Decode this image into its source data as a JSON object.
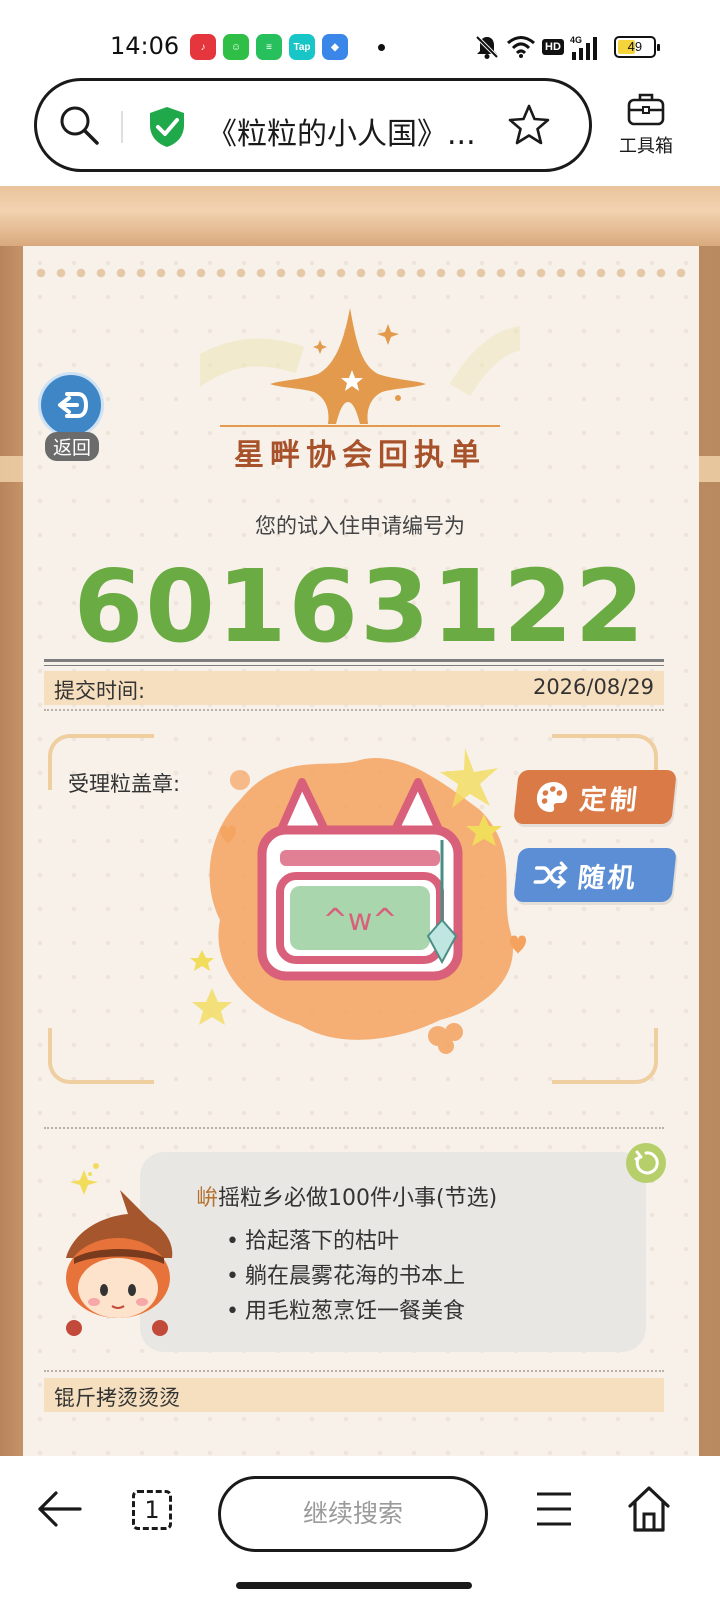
{
  "status_bar": {
    "time": "14:06",
    "battery_percent": "49",
    "battery_level": 0.49,
    "app_icons": [
      {
        "name": "music-app-icon",
        "label": "♪",
        "color": "#e5353d"
      },
      {
        "name": "green-app-icon",
        "label": "☺",
        "color": "#2fbf47"
      },
      {
        "name": "chat-app-icon",
        "label": "≡",
        "color": "#28c05c"
      },
      {
        "name": "taptap-app-icon",
        "label": "Tap",
        "color": "#18c6c7"
      },
      {
        "name": "blue-app-icon",
        "label": "◆",
        "color": "#3a86e9"
      }
    ],
    "hd_label": "HD",
    "network_label": "4G"
  },
  "browser": {
    "address_title": "《粒粒的小人国》...",
    "toolbox_label": "工具箱",
    "continue_search": "继续搜索",
    "tab_count": "1"
  },
  "page": {
    "back_label": "返回",
    "logo_title": "星畔协会回执单",
    "subtitle": "您的试入住申请编号为",
    "application_number": "60163122",
    "submit_label": "提交时间:",
    "submit_date": "2026/08/29",
    "stamp_label": "受理粒盖章:",
    "stamp_face": "^w^",
    "custom_button": "定制",
    "random_button": "随机",
    "todo": {
      "title_accent": "峅",
      "title_rest": "摇粒乡必做100件小事(节选)",
      "items": [
        "拾起落下的枯叶",
        "躺在晨雾花海的书本上",
        "用毛粒葱烹饪一餐美食"
      ]
    },
    "bottom_section_label": "锟斤拷烫烫烫"
  },
  "colors": {
    "number_green": "#6aab43",
    "logo_brown": "#a7522a",
    "custom_orange": "#d97a47",
    "random_blue": "#5b8ed4",
    "stamp_pink": "#d9607a",
    "stamp_orange": "#f4a25e"
  }
}
